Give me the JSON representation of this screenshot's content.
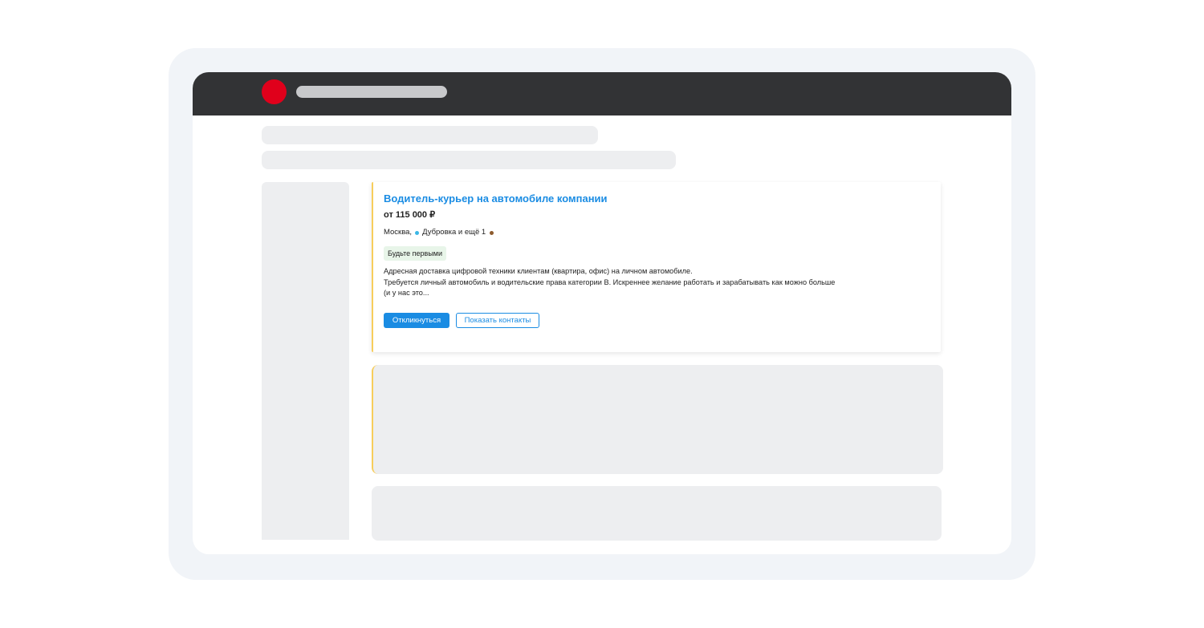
{
  "colors": {
    "topbar": "#323335",
    "logo": "#e0001b",
    "accent": "#1a8ce3",
    "card_highlight": "#f7cd5b",
    "badge_bg": "#e8f5e9"
  },
  "vacancy": {
    "title": "Водитель-курьер на автомобиле компании",
    "salary": "от 115 000 ₽",
    "location": {
      "city": "Москва,",
      "metro": "Дубровка и ещё 1"
    },
    "badge": "Будьте первыми",
    "description": [
      "Адресная доставка цифровой техники клиентам (квартира, офис) на личном автомобиле.",
      "Требуется личный автомобиль и водительские права категории B. Искреннее желание работать и зарабатывать как можно больше",
      "(и у нас это..."
    ],
    "actions": {
      "respond_label": "Откликнуться",
      "contacts_label": "Показать контакты"
    }
  }
}
